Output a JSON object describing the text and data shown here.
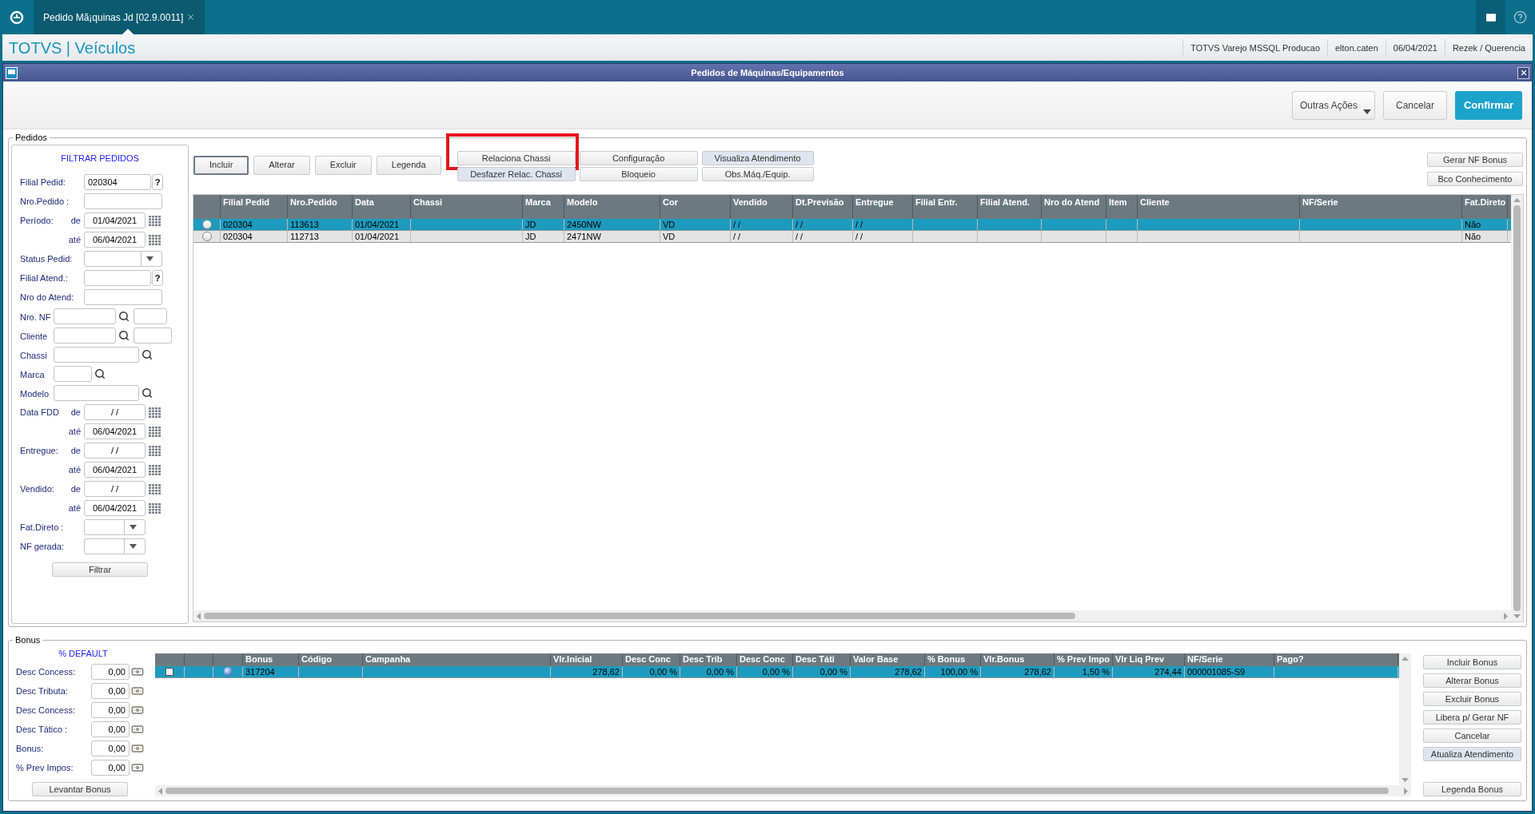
{
  "top_bar": {
    "tab": {
      "title": "Pedido Mã¡quinas Jd [02.9.0011]",
      "selected": true
    }
  },
  "header": {
    "title": "TOTVS | Veículos",
    "info": [
      "TOTVS Varejo MSSQL Producao",
      "elton.caten",
      "06/04/2021",
      "Rezek / Querencia"
    ]
  },
  "dialog": {
    "title": "Pedidos de Máquinas/Equipamentos",
    "actions": [
      {
        "label": "Outras Ações",
        "kind": "menu"
      },
      {
        "label": "Cancelar",
        "kind": "plain"
      },
      {
        "label": "Confirmar",
        "kind": "primary"
      }
    ]
  },
  "pedidos": {
    "legend": "Pedidos",
    "filter": {
      "title": "FILTRAR PEDIDOS",
      "button": "Filtrar",
      "fields": [
        {
          "label": "Filial Pedid:",
          "kind": "help",
          "value": "020304",
          "button": "?"
        },
        {
          "label": "Nro.Pedido  :",
          "kind": "text"
        },
        {
          "label": "Período:",
          "connector": "de",
          "kind": "date",
          "value": "01/04/2021"
        },
        {
          "connector": "até",
          "kind": "date",
          "value": "06/04/2021"
        },
        {
          "label": "Status Pedid:",
          "kind": "select"
        },
        {
          "label": "Filial Atend.:",
          "kind": "help",
          "button": "?"
        },
        {
          "label": "Nro do Atend:",
          "kind": "text"
        },
        {
          "label": "Nro. NF",
          "kind": "search_extra"
        },
        {
          "label": "Cliente",
          "kind": "search_extra_wide"
        },
        {
          "label": "Chassi",
          "kind": "search"
        },
        {
          "label": "Marca",
          "kind": "search_short"
        },
        {
          "label": "Modelo",
          "kind": "search"
        },
        {
          "label": "Data FDD",
          "connector": "de",
          "kind": "date",
          "value": "/ /"
        },
        {
          "connector": "até",
          "kind": "date",
          "value": "06/04/2021"
        },
        {
          "label": "Entregue:",
          "connector": "de",
          "kind": "date",
          "value": "/ /"
        },
        {
          "connector": "até",
          "kind": "date",
          "value": "06/04/2021"
        },
        {
          "label": "Vendido:",
          "connector": "de",
          "kind": "date",
          "value": "/ /"
        },
        {
          "connector": "até",
          "kind": "date",
          "value": "06/04/2021"
        },
        {
          "label": "Fat.Direto  :",
          "kind": "select_short"
        },
        {
          "label": "NF gerada:",
          "kind": "select_short"
        }
      ]
    },
    "toolbar": [
      {
        "label": "Incluir",
        "focused": true
      },
      {
        "label": "Alterar",
        "focused": false
      },
      {
        "label": "Excluir",
        "focused": false
      },
      {
        "label": "Legenda",
        "focused": false
      }
    ],
    "actions": [
      {
        "label": "Relaciona Chassi",
        "tinted": false,
        "highlighted": true
      },
      {
        "label": "Configuração",
        "tinted": false,
        "highlighted": false
      },
      {
        "label": "Visualiza Atendimento",
        "tinted": true,
        "highlighted": false
      },
      {
        "label": "Desfazer Relac. Chassi",
        "tinted": true,
        "highlighted": false
      },
      {
        "label": "Bloqueio",
        "tinted": false,
        "highlighted": false
      },
      {
        "label": "Obs.Máq./Equip.",
        "tinted": false,
        "highlighted": false
      }
    ],
    "side_buttons": [
      "Gerar NF Bonus",
      "Bco Conhecimento"
    ],
    "table": {
      "columns": [
        "Filial Pedid",
        "Nro.Pedido",
        "Data",
        "Chassi",
        "Marca",
        "Modelo",
        "Cor",
        "Vendido",
        "Dt.Previsão",
        "Entregue",
        "Filial Entr.",
        "Filial Atend.",
        "Nro do Atend",
        "Item",
        "Cliente",
        "NF/Serie",
        "Fat.Direto"
      ],
      "rows": [
        {
          "selected": true,
          "cells": [
            "020304",
            "113613",
            "01/04/2021",
            null,
            "JD",
            "2450NW",
            "VD",
            "/ /",
            "/ /",
            "/ /",
            null,
            null,
            null,
            null,
            null,
            null,
            "Não"
          ]
        },
        {
          "selected": false,
          "cells": [
            "020304",
            "112713",
            "01/04/2021",
            null,
            "JD",
            "2471NW",
            "VD",
            "/ /",
            "/ /",
            "/ /",
            null,
            null,
            null,
            null,
            null,
            null,
            "Não"
          ]
        }
      ]
    }
  },
  "bonus": {
    "legend": "Bonus",
    "defaults": {
      "title": "% DEFAULT",
      "button": "Levantar Bonus",
      "fields": [
        {
          "label": "Desc Concess:",
          "value": "0,00"
        },
        {
          "label": "Desc Tributa:",
          "value": "0,00"
        },
        {
          "label": "Desc Concess:",
          "value": "0,00"
        },
        {
          "label": "Desc Tático :",
          "value": "0,00"
        },
        {
          "label": "Bonus:",
          "value": "0,00"
        },
        {
          "label": "% Prev Impos:",
          "value": "0,00"
        }
      ]
    },
    "table": {
      "columns": [
        "Bonus",
        "Código",
        "Campanha",
        "Vlr.Inicial",
        "Desc Conc",
        "Desc Trib",
        "Desc Conc",
        "Desc Táti",
        "Valor Base",
        "% Bonus",
        "Vlr.Bonus",
        "% Prev Impo",
        "Vlr Liq Prev",
        "NF/Serie",
        "Pago?"
      ],
      "rows": [
        {
          "selected": true,
          "checked": false,
          "cells": [
            "317204",
            null,
            null,
            "278,62",
            "0,00 %",
            "0,00 %",
            "0,00 %",
            "0,00 %",
            "278,62",
            "100,00 %",
            "278,62",
            "1,50 %",
            "274,44",
            "000001085-S9",
            null
          ]
        }
      ]
    },
    "side_buttons": [
      {
        "label": "Incluir Bonus",
        "tinted": false
      },
      {
        "label": "Alterar Bonus",
        "tinted": false
      },
      {
        "label": "Excluir Bonus",
        "tinted": false
      },
      {
        "label": "Libera p/ Gerar NF",
        "tinted": false
      },
      {
        "label": "Cancelar",
        "tinted": false
      },
      {
        "label": "Atualiza Atendimento",
        "tinted": true
      }
    ],
    "legend_button": "Legenda Bonus"
  }
}
